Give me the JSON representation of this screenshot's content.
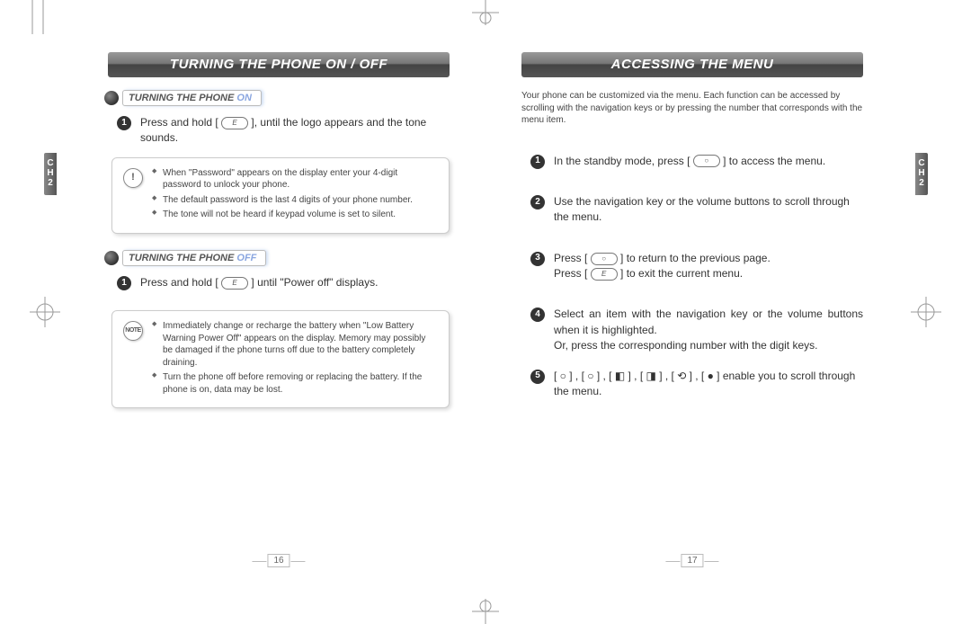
{
  "left_page": {
    "header": "TURNING THE PHONE ON / OFF",
    "chapter_tab": "C\nH\n2",
    "section_on": {
      "title_main": "TURNING THE PHONE ",
      "title_accent": "ON",
      "step1_before": "Press and hold [ ",
      "step1_icon": "E",
      "step1_after": " ], until the logo appears and the tone sounds.",
      "note_icon": "!",
      "notes": [
        "When \"Password\" appears on the display enter your 4-digit password to unlock your phone.",
        "The default password is the last 4 digits of your phone number.",
        "The tone will not be heard if keypad volume is set to silent."
      ]
    },
    "section_off": {
      "title_main": "TURNING THE PHONE ",
      "title_accent": "OFF",
      "step1_before": "Press and hold [ ",
      "step1_icon": "E",
      "step1_after": " ] until \"Power off\" displays.",
      "note_icon": "NOTE",
      "notes": [
        "Immediately change or recharge the battery when \"Low Battery Warning Power Off\" appears on the display. Memory may possibly be damaged if the phone turns off due to the battery completely draining.",
        "Turn the phone off before removing or replacing the battery. If the phone is on, data may be lost."
      ]
    },
    "page_num": "16"
  },
  "right_page": {
    "header": "ACCESSING THE MENU",
    "chapter_tab": "C\nH\n2",
    "intro": "Your phone can be customized via the menu. Each function can be accessed by scrolling with the navigation keys or by pressing the number that corresponds with the menu item.",
    "steps": {
      "s1_before": "In the standby mode, press [ ",
      "s1_icon": "○",
      "s1_after": " ] to access the menu.",
      "s2": "Use the navigation key or the volume buttons to scroll through the menu.",
      "s3_a_before": "Press [ ",
      "s3_a_icon": "○",
      "s3_a_after": " ] to return to the previous page.",
      "s3_b_before": "Press [ ",
      "s3_b_icon": "E",
      "s3_b_after": " ] to exit the current menu.",
      "s4": "Select an item with the navigation key or the volume buttons when it is highlighted.\nOr, press the corresponding number with the digit keys.",
      "s5": "[ ○ ] , [ ○ ] , [ ◧ ] , [ ◨ ] , [ ⟲ ] , [ ● ] enable you to scroll through the menu."
    },
    "page_num": "17"
  }
}
